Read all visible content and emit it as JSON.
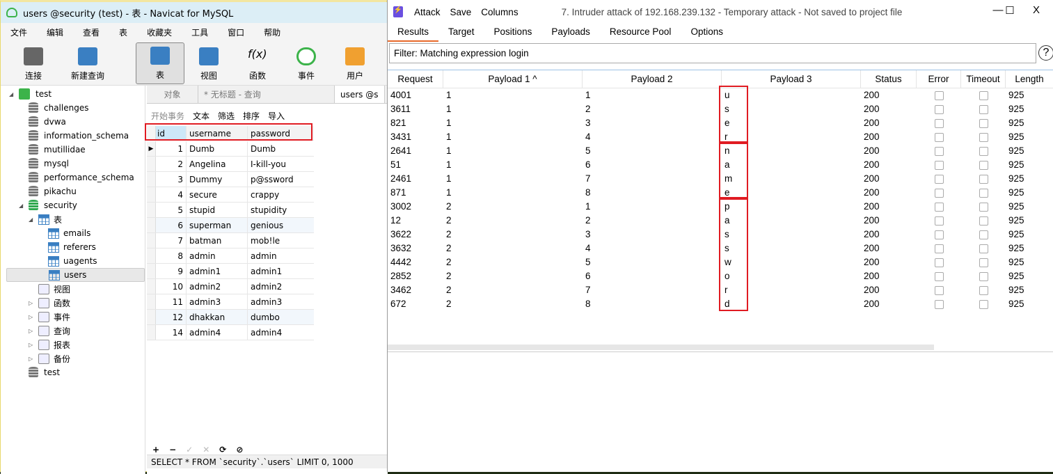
{
  "navicat": {
    "title": "users @security (test) - 表 - Navicat for MySQL",
    "menu": [
      "文件",
      "编辑",
      "查看",
      "表",
      "收藏夹",
      "工具",
      "窗口",
      "帮助"
    ],
    "toolbar": [
      "连接",
      "新建查询",
      "表",
      "视图",
      "函数",
      "事件",
      "用户"
    ],
    "active_tool": "表",
    "tree": [
      {
        "label": "test",
        "level": 0,
        "icon": "connection-icon",
        "expander": "◢"
      },
      {
        "label": "challenges",
        "level": 1,
        "icon": "database-icon"
      },
      {
        "label": "dvwa",
        "level": 1,
        "icon": "database-icon"
      },
      {
        "label": "information_schema",
        "level": 1,
        "icon": "database-icon"
      },
      {
        "label": "mutillidae",
        "level": 1,
        "icon": "database-icon"
      },
      {
        "label": "mysql",
        "level": 1,
        "icon": "database-icon"
      },
      {
        "label": "performance_schema",
        "level": 1,
        "icon": "database-icon"
      },
      {
        "label": "pikachu",
        "level": 1,
        "icon": "database-icon"
      },
      {
        "label": "security",
        "level": 1,
        "icon": "database-open-icon",
        "expander": "◢"
      },
      {
        "label": "表",
        "level": 2,
        "icon": "table-icon",
        "expander": "◢"
      },
      {
        "label": "emails",
        "level": 3,
        "icon": "table-icon"
      },
      {
        "label": "referers",
        "level": 3,
        "icon": "table-icon"
      },
      {
        "label": "uagents",
        "level": 3,
        "icon": "table-icon"
      },
      {
        "label": "users",
        "level": 3,
        "icon": "table-icon",
        "selected": true
      },
      {
        "label": "视图",
        "level": 2,
        "icon": "view-icon"
      },
      {
        "label": "函数",
        "level": 2,
        "icon": "function-icon",
        "expander": "▷"
      },
      {
        "label": "事件",
        "level": 2,
        "icon": "event-icon",
        "expander": "▷"
      },
      {
        "label": "查询",
        "level": 2,
        "icon": "query-icon",
        "expander": "▷"
      },
      {
        "label": "报表",
        "level": 2,
        "icon": "report-icon",
        "expander": "▷"
      },
      {
        "label": "备份",
        "level": 2,
        "icon": "backup-icon",
        "expander": "▷"
      },
      {
        "label": "test",
        "level": 1,
        "icon": "database-icon"
      }
    ],
    "tabs": [
      "对象",
      "* 无标题 - 查询",
      "users @s"
    ],
    "table_tools": [
      "开始事务",
      "文本",
      "筛选",
      "排序",
      "导入"
    ],
    "columns": [
      "id",
      "username",
      "password"
    ],
    "rows": [
      [
        "1",
        "Dumb",
        "Dumb"
      ],
      [
        "2",
        "Angelina",
        "I-kill-you"
      ],
      [
        "3",
        "Dummy",
        "p@ssword"
      ],
      [
        "4",
        "secure",
        "crappy"
      ],
      [
        "5",
        "stupid",
        "stupidity"
      ],
      [
        "6",
        "superman",
        "genious"
      ],
      [
        "7",
        "batman",
        "mob!le"
      ],
      [
        "8",
        "admin",
        "admin"
      ],
      [
        "9",
        "admin1",
        "admin1"
      ],
      [
        "10",
        "admin2",
        "admin2"
      ],
      [
        "11",
        "admin3",
        "admin3"
      ],
      [
        "12",
        "dhakkan",
        "dumbo"
      ],
      [
        "14",
        "admin4",
        "admin4"
      ]
    ],
    "bottom_buttons": [
      "+",
      "−",
      "✓",
      "✕",
      "⟳",
      "⊘"
    ],
    "status_sql": "SELECT * FROM `security`.`users` LIMIT 0, 1000"
  },
  "burp": {
    "menu": [
      "Attack",
      "Save",
      "Columns"
    ],
    "title": "7. Intruder attack of 192.168.239.132 - Temporary attack - Not saved to project file",
    "window_buttons": [
      "—",
      "☐",
      "X"
    ],
    "tabs": [
      "Results",
      "Target",
      "Positions",
      "Payloads",
      "Resource Pool",
      "Options"
    ],
    "active_tab": "Results",
    "filter": "Filter: Matching expression login",
    "columns": [
      "Request",
      "Payload 1 ^",
      "Payload 2",
      "Payload 3",
      "Status",
      "Error",
      "Timeout",
      "Length"
    ],
    "rows": [
      [
        "4001",
        "1",
        "1",
        "u",
        "200",
        "925"
      ],
      [
        "3611",
        "1",
        "2",
        "s",
        "200",
        "925"
      ],
      [
        "821",
        "1",
        "3",
        "e",
        "200",
        "925"
      ],
      [
        "3431",
        "1",
        "4",
        "r",
        "200",
        "925"
      ],
      [
        "2641",
        "1",
        "5",
        "n",
        "200",
        "925"
      ],
      [
        "51",
        "1",
        "6",
        "a",
        "200",
        "925"
      ],
      [
        "2461",
        "1",
        "7",
        "m",
        "200",
        "925"
      ],
      [
        "871",
        "1",
        "8",
        "e",
        "200",
        "925"
      ],
      [
        "3002",
        "2",
        "1",
        "p",
        "200",
        "925"
      ],
      [
        "12",
        "2",
        "2",
        "a",
        "200",
        "925"
      ],
      [
        "3622",
        "2",
        "3",
        "s",
        "200",
        "925"
      ],
      [
        "3632",
        "2",
        "4",
        "s",
        "200",
        "925"
      ],
      [
        "4442",
        "2",
        "5",
        "w",
        "200",
        "925"
      ],
      [
        "2852",
        "2",
        "6",
        "o",
        "200",
        "925"
      ],
      [
        "3462",
        "2",
        "7",
        "r",
        "200",
        "925"
      ],
      [
        "672",
        "2",
        "8",
        "d",
        "200",
        "925"
      ]
    ],
    "accent": "#e8692a",
    "highlight": "#e01b22"
  }
}
